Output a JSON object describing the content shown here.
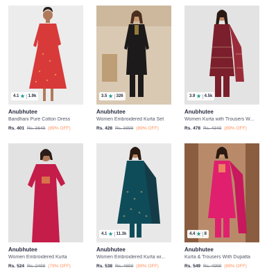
{
  "products": [
    {
      "brand": "Anubhutee",
      "name": "Bandhani Pure Cotton Dress",
      "price": "Rs. 401",
      "mrp": "Rs. 3649",
      "discount": "(89% OFF)",
      "rating": "4.1",
      "count": "1.9k",
      "star_icon": "star-icon",
      "bg": "#ececec",
      "dress": "#d83a3a"
    },
    {
      "brand": "Anubhutee",
      "name": "Women Embroidered Kurta Set",
      "price": "Rs. 428",
      "mrp": "Rs. 3899",
      "discount": "(89% OFF)",
      "rating": "3.5",
      "count": "326",
      "star_icon": "star-icon",
      "bg": "#d9c9b3",
      "dress": "#1c1a1a"
    },
    {
      "brand": "Anubhutee",
      "name": "Women Kurta with Trousers W...",
      "price": "Rs. 478",
      "mrp": "Rs. 4349",
      "discount": "(89% OFF)",
      "rating": "3.9",
      "count": "4.5k",
      "star_icon": "star-icon",
      "bg": "#e3e3e3",
      "dress": "#7a1f2b"
    },
    {
      "brand": "Anubhutee",
      "name": "Women Embroidered Kurta",
      "price": "Rs. 524",
      "mrp": "Rs. 2499",
      "discount": "(79% OFF)",
      "rating": "",
      "count": "",
      "star_icon": "",
      "bg": "#e2e2e2",
      "dress": "#c41d4a"
    },
    {
      "brand": "Anubhutee",
      "name": "Women Embroidered Kurta wi...",
      "price": "Rs. 538",
      "mrp": "Rs. 4899",
      "discount": "(89% OFF)",
      "rating": "4.1",
      "count": "11.3k",
      "star_icon": "star-icon",
      "bg": "#e8e8e8",
      "dress": "#0f4c5a"
    },
    {
      "brand": "Anubhutee",
      "name": "Kurta & Trousers With Dupatta",
      "price": "Rs. 549",
      "mrp": "Rs. 4999",
      "discount": "(89% OFF)",
      "rating": "4.4",
      "count": "8",
      "star_icon": "star-icon",
      "bg": "#b98a6a",
      "dress": "#e0206e"
    }
  ]
}
